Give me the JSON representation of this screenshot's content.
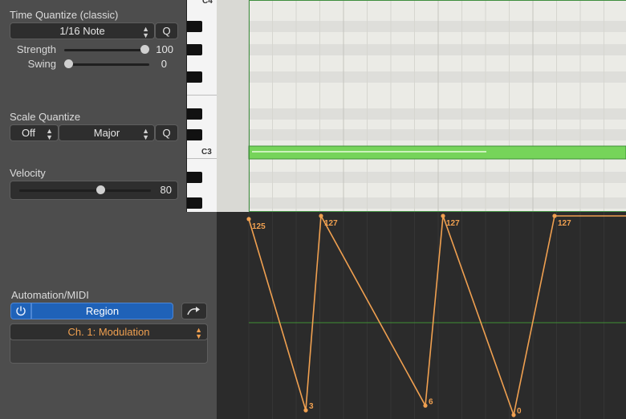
{
  "time_quantize": {
    "title": "Time Quantize (classic)",
    "value": "1/16 Note",
    "q_label": "Q",
    "strength_label": "Strength",
    "strength_value": "100",
    "strength_fraction": 1.0,
    "swing_label": "Swing",
    "swing_value": "0",
    "swing_fraction": 0.0
  },
  "scale_quantize": {
    "title": "Scale Quantize",
    "root_value": "Off",
    "scale_value": "Major",
    "q_label": "Q"
  },
  "velocity": {
    "title": "Velocity",
    "value": "80",
    "fraction": 0.63
  },
  "automation": {
    "title": "Automation/MIDI",
    "mode": "Region",
    "parameter": "Ch. 1: Modulation"
  },
  "piano": {
    "label_top": "C4",
    "label_c3": "C3"
  },
  "automation_points": [
    {
      "label": "125",
      "value": 125
    },
    {
      "label": "3",
      "value": 3
    },
    {
      "label": "127",
      "value": 127
    },
    {
      "label": "6",
      "value": 6
    },
    {
      "label": "127",
      "value": 127
    },
    {
      "label": "0",
      "value": 0
    },
    {
      "label": "127",
      "value": 127
    }
  ],
  "colors": {
    "accent_blue": "#1f62b8",
    "automation_orange": "#f0a050",
    "param_orange": "#f0a050",
    "note_green": "#76d45a"
  }
}
